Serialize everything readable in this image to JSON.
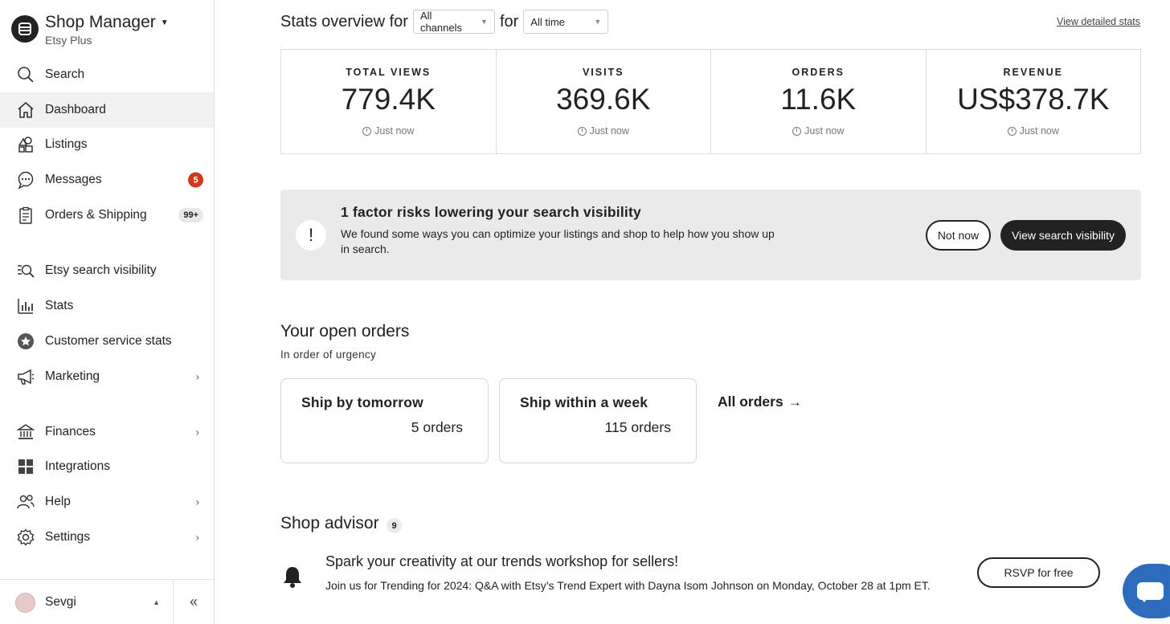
{
  "sidebar": {
    "brand": {
      "title": "Shop Manager",
      "subtitle": "Etsy Plus"
    },
    "items": [
      {
        "label": "Search",
        "icon": "search-icon"
      },
      {
        "label": "Dashboard",
        "icon": "home-icon"
      },
      {
        "label": "Listings",
        "icon": "listings-icon"
      },
      {
        "label": "Messages",
        "icon": "messages-icon",
        "badge": "5"
      },
      {
        "label": "Orders & Shipping",
        "icon": "clipboard-icon",
        "badge": "99+"
      },
      {
        "label": "Etsy search visibility",
        "icon": "search-visibility-icon"
      },
      {
        "label": "Stats",
        "icon": "bar-chart-icon"
      },
      {
        "label": "Customer service stats",
        "icon": "star-badge-icon"
      },
      {
        "label": "Marketing",
        "icon": "megaphone-icon"
      },
      {
        "label": "Finances",
        "icon": "bank-icon"
      },
      {
        "label": "Integrations",
        "icon": "grid-icon"
      },
      {
        "label": "Help",
        "icon": "people-icon"
      },
      {
        "label": "Settings",
        "icon": "gear-icon"
      }
    ],
    "user": {
      "name": "Sevgi"
    }
  },
  "stats": {
    "heading_prefix": "Stats overview for",
    "heading_mid": "for",
    "channel_select": "All channels",
    "time_select": "All time",
    "detailed_link": "View detailed stats",
    "cards": [
      {
        "label": "TOTAL VIEWS",
        "value": "779.4K",
        "time": "Just now"
      },
      {
        "label": "VISITS",
        "value": "369.6K",
        "time": "Just now"
      },
      {
        "label": "ORDERS",
        "value": "11.6K",
        "time": "Just now"
      },
      {
        "label": "REVENUE",
        "value": "US$378.7K",
        "time": "Just now"
      }
    ]
  },
  "alert": {
    "icon": "!",
    "title": "1 factor risks lowering your search visibility",
    "body": "We found some ways you can optimize your listings and shop to help how you show up in search.",
    "not_now": "Not now",
    "view_visibility": "View search visibility"
  },
  "orders": {
    "title": "Your open orders",
    "subtitle": "In order of urgency",
    "cards": [
      {
        "title": "Ship by tomorrow",
        "count": "5 orders"
      },
      {
        "title": "Ship within a week",
        "count": "115 orders"
      }
    ],
    "all_orders": "All orders",
    "all_orders_arrow": "→"
  },
  "advisor": {
    "title": "Shop advisor",
    "count": "9",
    "item_title": "Spark your creativity at our trends workshop for sellers!",
    "item_body": "Join us for Trending for 2024: Q&A with Etsy’s Trend Expert with Dayna Isom Johnson on Monday, October 28 at 1pm ET.",
    "rsvp": "RSVP for free"
  },
  "colors": {
    "badge_red": "#cc3c1a",
    "chat_blue": "#2d6bbd",
    "alert_bg": "#eaeaea",
    "active_nav": "#f1f1f1"
  }
}
